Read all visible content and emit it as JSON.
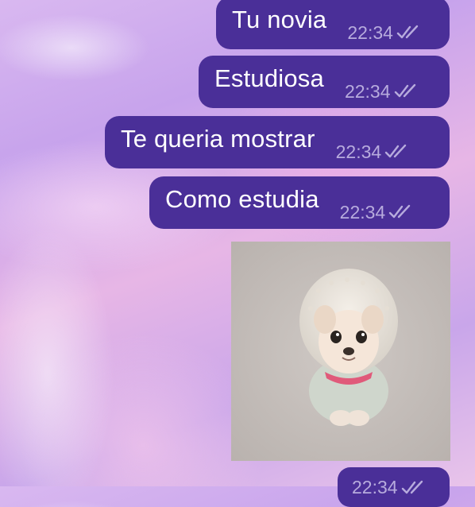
{
  "messages": [
    {
      "text": "Tu novia",
      "time": "22:34",
      "status_icon": "double-check-icon"
    },
    {
      "text": "Estudiosa",
      "time": "22:34",
      "status_icon": "double-check-icon"
    },
    {
      "text": "Te queria mostrar",
      "time": "22:34",
      "status_icon": "double-check-icon"
    },
    {
      "text": "Como estudia",
      "time": "22:34",
      "status_icon": "double-check-icon"
    }
  ],
  "image_message": {
    "subject": "puppy-in-hoodie-image"
  },
  "partial_message": {
    "time": "22:34",
    "status_icon": "double-check-icon"
  },
  "colors": {
    "bubble": "#4a2f98",
    "meta_text": "#b7abdd",
    "text": "#ffffff"
  }
}
